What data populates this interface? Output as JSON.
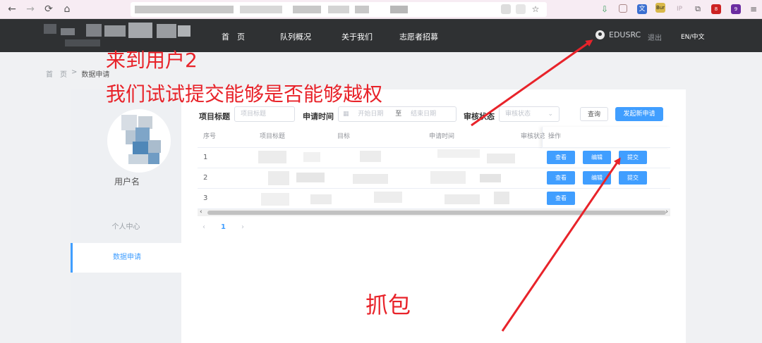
{
  "browser": {
    "back_icon": "←",
    "forward_icon": "→",
    "reload_icon": "⟳",
    "home_icon": "⌂",
    "extensions": [
      "download-icon",
      "reader-icon",
      "translate-icon",
      "burp-icon",
      "ip-icon",
      "puzzle-icon",
      "notify-icon",
      "menu-icon"
    ],
    "ext_labels": {
      "burp": "Bur",
      "ip": "IP",
      "badge1": "8",
      "badge2": "9"
    }
  },
  "header": {
    "nav": [
      "首　页",
      "队列概况",
      "关于我们",
      "志愿者招募"
    ],
    "user": "EDUSRC",
    "logout": "退出",
    "lang": "EN/中文"
  },
  "breadcrumb": {
    "home": "首　页",
    "sep": ">",
    "current": "数据申请"
  },
  "sidebar": {
    "username": "用户名",
    "items": [
      "个人中心",
      "数据申请"
    ]
  },
  "filters": {
    "project_title_label": "项目标题",
    "project_title_placeholder": "项目标题",
    "apply_time_label": "申请时间",
    "start_placeholder": "开始日期",
    "to": "至",
    "end_placeholder": "结束日期",
    "review_status_label": "审核状态",
    "review_status_placeholder": "审核状态",
    "query_button": "查询",
    "new_apply_button": "发起新申请"
  },
  "table": {
    "headers": [
      "序号",
      "项目标题",
      "目标",
      "申请时间",
      "审核状态",
      "操作"
    ],
    "rows": [
      {
        "idx": "1",
        "actions": [
          "查看",
          "编辑",
          "提交"
        ]
      },
      {
        "idx": "2",
        "actions": [
          "查看",
          "编辑",
          "提交"
        ]
      },
      {
        "idx": "3",
        "actions": [
          "查看"
        ]
      }
    ]
  },
  "pager": {
    "prev": "‹",
    "page": "1",
    "next": "›"
  },
  "annotations": {
    "line1": "来到用户2",
    "line2": "我们试试提交能够是否能够越权",
    "capture": "抓包"
  },
  "colors": {
    "accent": "#409eff",
    "annotation": "#e8232a",
    "header_bg": "#2f3133"
  }
}
